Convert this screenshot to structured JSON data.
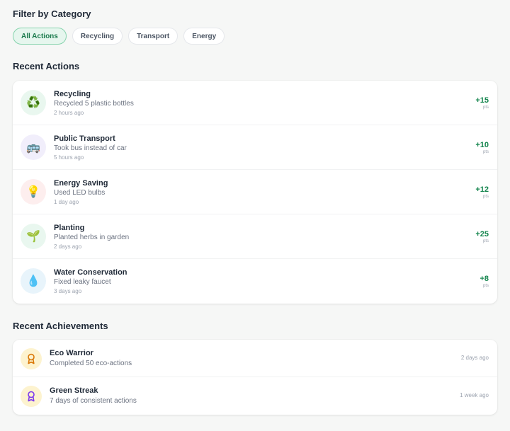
{
  "filters": {
    "heading": "Filter by Category",
    "chips": [
      "All Actions",
      "Recycling",
      "Transport",
      "Energy"
    ],
    "active": "All Actions"
  },
  "recent_actions": {
    "heading": "Recent Actions",
    "items": [
      {
        "title": "Recycling",
        "desc": "Recycled 5 plastic bottles",
        "time": "2 hours ago",
        "points": "+15",
        "unit": "pts",
        "icon": "recycle-icon",
        "glyph": "♻️",
        "bg": "#e9f7ef"
      },
      {
        "title": "Public Transport",
        "desc": "Took bus instead of car",
        "time": "5 hours ago",
        "points": "+10",
        "unit": "pts",
        "icon": "bus-icon",
        "glyph": "🚌",
        "bg": "#f1eefb"
      },
      {
        "title": "Energy Saving",
        "desc": "Used LED bulbs",
        "time": "1 day ago",
        "points": "+12",
        "unit": "pts",
        "icon": "lightbulb-icon",
        "glyph": "💡",
        "bg": "#fdeeee"
      },
      {
        "title": "Planting",
        "desc": "Planted herbs in garden",
        "time": "2 days ago",
        "points": "+25",
        "unit": "pts",
        "icon": "seedling-icon",
        "glyph": "🌱",
        "bg": "#e9f7ef"
      },
      {
        "title": "Water Conservation",
        "desc": "Fixed leaky faucet",
        "time": "3 days ago",
        "points": "+8",
        "unit": "pts",
        "icon": "water-drop-icon",
        "glyph": "💧",
        "bg": "#e8f4fb"
      }
    ]
  },
  "recent_achievements": {
    "heading": "Recent Achievements",
    "items": [
      {
        "title": "Eco Warrior",
        "desc": "Completed 50 eco-actions",
        "time": "2 days ago",
        "icon": "award-icon",
        "color": "#d97706"
      },
      {
        "title": "Green Streak",
        "desc": "7 days of consistent actions",
        "time": "1 week ago",
        "icon": "award-icon",
        "color": "#7c3aed"
      }
    ]
  }
}
